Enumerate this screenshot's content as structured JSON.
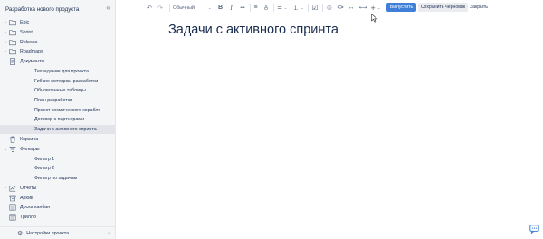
{
  "sidebar": {
    "title": "Разработка нового продукта",
    "collapse_glyph": "«",
    "items": [
      {
        "label": "Epic",
        "icon": "folder-icon",
        "has_chevron": true
      },
      {
        "label": "Sprint",
        "icon": "folder-icon",
        "has_chevron": true
      },
      {
        "label": "Release",
        "icon": "folder-icon",
        "has_chevron": true
      },
      {
        "label": "Roadmaps",
        "icon": "folder-icon",
        "has_chevron": true
      },
      {
        "label": "Документы",
        "icon": "document-icon",
        "has_chevron": true,
        "expanded": true
      },
      {
        "label": "Техзадание для проекта"
      },
      {
        "label": "Гибкие методики разработки"
      },
      {
        "label": "Обновленные таблицы"
      },
      {
        "label": "План разработки"
      },
      {
        "label": "Проект космического корабля"
      },
      {
        "label": "Договор с партнерами"
      },
      {
        "label": "Задачи с активного спринта",
        "active": true
      },
      {
        "label": "Корзина",
        "icon": "trash-icon"
      },
      {
        "label": "Фильтры",
        "icon": "filter-icon",
        "has_chevron": true,
        "expanded": true
      },
      {
        "label": "Фильтр 1"
      },
      {
        "label": "Фильтр 2"
      },
      {
        "label": "Фильтр по задачам"
      },
      {
        "label": "Отчеты",
        "icon": "chart-icon",
        "has_chevron": true
      },
      {
        "label": "Архив",
        "icon": "archive-icon"
      },
      {
        "label": "Доска канбан",
        "icon": "board-icon"
      },
      {
        "label": "Трилло",
        "icon": "board-icon"
      }
    ],
    "footer": {
      "label": "Настройки проекта",
      "icon": "gear-icon",
      "collapse_glyph": "«"
    }
  },
  "toolbar": {
    "undo": "↶",
    "redo": "↷",
    "text_style": "Обычный",
    "bold": "B",
    "italic": "I",
    "more": "•••",
    "align": "≡",
    "bullet_list": "☰",
    "numbered_list": "⒈",
    "checkbox": "☑",
    "emoji": "☺",
    "code": "<>",
    "expand": "↔",
    "divider": "⊢⊣",
    "insert": "+",
    "publish_label": "Выпустить",
    "draft_label": "Сохранить черновик",
    "close_label": "Закрыть",
    "accent_color": "#3f7fd8"
  },
  "page": {
    "title": "Задачи с активного спринта"
  }
}
